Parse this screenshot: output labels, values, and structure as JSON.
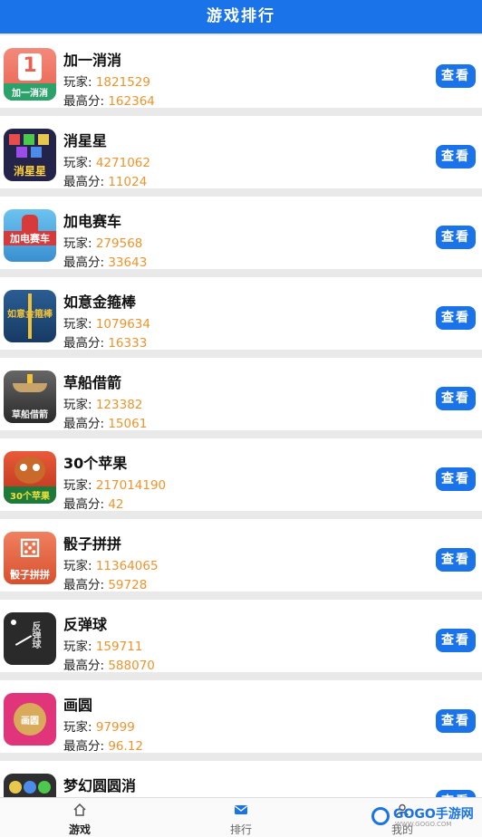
{
  "header": {
    "title": "游戏排行"
  },
  "labels": {
    "players": "玩家: ",
    "score": "最高分: ",
    "view": "查看"
  },
  "games": [
    {
      "name": "加一消消",
      "players": "1821529",
      "score": "162364",
      "icon": "number-one-tile-icon",
      "glyph": "1",
      "caption": "加一消消",
      "color": "#f07a6a"
    },
    {
      "name": "消星星",
      "players": "4271062",
      "score": "11024",
      "icon": "stars-icon",
      "glyph": "★",
      "caption": "消星星",
      "color": "#2a2a4a"
    },
    {
      "name": "加电赛车",
      "players": "279568",
      "score": "33643",
      "icon": "race-car-icon",
      "glyph": "🏎",
      "caption": "加电赛车",
      "color": "#3aa0d8"
    },
    {
      "name": "如意金箍棒",
      "players": "1079634",
      "score": "16333",
      "icon": "golden-staff-icon",
      "glyph": "",
      "caption": "如意金箍棒",
      "color": "#1f4a7a"
    },
    {
      "name": "草船借箭",
      "players": "123382",
      "score": "15061",
      "icon": "boat-arrows-icon",
      "glyph": "",
      "caption": "草船借箭",
      "color": "#333333"
    },
    {
      "name": "30个苹果",
      "players": "217014190",
      "score": "42",
      "icon": "squirrel-icon",
      "glyph": "",
      "caption": "30个苹果",
      "color": "#d6442a"
    },
    {
      "name": "骰子拼拼",
      "players": "11364065",
      "score": "59728",
      "icon": "dice-icon",
      "glyph": "⚄",
      "caption": "骰子拼拼",
      "color": "#e8603c"
    },
    {
      "name": "反弹球",
      "players": "159711",
      "score": "588070",
      "icon": "bounce-ball-icon",
      "glyph": "",
      "caption": "反弹球",
      "color": "#2b2b2b"
    },
    {
      "name": "画圆",
      "players": "97999",
      "score": "96.12",
      "icon": "draw-circle-icon",
      "glyph": "",
      "caption": "画圆",
      "color": "#e0357a"
    },
    {
      "name": "梦幻圆圆消",
      "players": "",
      "score": "",
      "icon": "bubbles-icon",
      "glyph": "",
      "caption": "",
      "color": "#2f2f2f"
    }
  ],
  "tabs": [
    {
      "label": "游戏",
      "icon": "home-icon"
    },
    {
      "label": "排行",
      "icon": "mail-icon"
    },
    {
      "label": "我的",
      "icon": "user-icon"
    }
  ],
  "watermark": {
    "main": "GOGO手游网",
    "sub": "WWW.GOGO.COM"
  }
}
